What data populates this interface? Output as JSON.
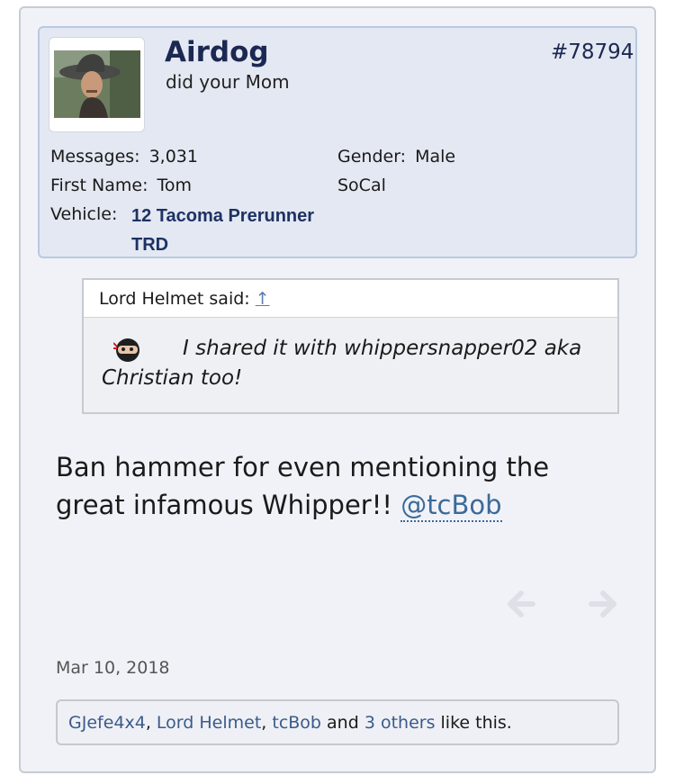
{
  "user": {
    "name": "Airdog",
    "title": "did your Mom",
    "post_number": "#78794",
    "messages_label": "Messages:",
    "messages_value": "3,031",
    "first_name_label": "First Name:",
    "first_name_value": "Tom",
    "vehicle_label": "Vehicle:",
    "vehicle_value": "12 Tacoma Prerunner TRD",
    "gender_label": "Gender:",
    "gender_value": "Male",
    "location": "SoCal"
  },
  "quote": {
    "author": "Lord Helmet said:",
    "arrow": "↑",
    "text": "I shared it with whippersnapper02 aka Christian too!"
  },
  "message": {
    "text": "Ban hammer for even mentioning the great infamous Whipper!! ",
    "mention": "@tcBob"
  },
  "post_date": "Mar 10, 2018",
  "likes": {
    "user1": "GJefe4x4",
    "sep1": ", ",
    "user2": "Lord Helmet",
    "sep2": ", ",
    "user3": "tcBob",
    "and": " and ",
    "others": "3 others",
    "suffix": " like this."
  },
  "icons": {
    "prev": "arrow-left-icon",
    "next": "arrow-right-icon",
    "smiley": "ninja-smiley-icon"
  }
}
